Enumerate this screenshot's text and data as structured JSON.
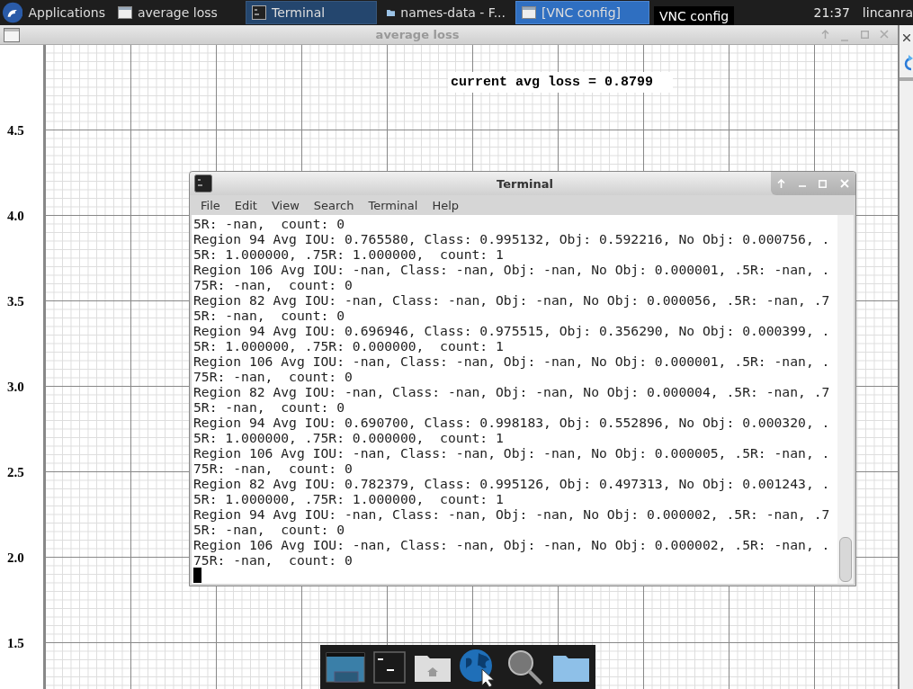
{
  "taskbar": {
    "menu": "Applications",
    "tasks": [
      {
        "label": "average loss",
        "kind": "window",
        "selected": false,
        "highlighted": false
      },
      {
        "label": "Terminal",
        "kind": "terminal",
        "selected": false,
        "highlighted": true
      },
      {
        "label": "names-data - F...",
        "kind": "folder",
        "selected": false,
        "highlighted": false
      },
      {
        "label": "[VNC config]",
        "kind": "window",
        "selected": true,
        "highlighted": false
      }
    ],
    "tooltip": "VNC config",
    "clock": "21:37",
    "user": "lincanra"
  },
  "plot_window": {
    "title": "average loss",
    "overlay_text": "current avg loss = 0.8799",
    "y_labels": [
      "4.5",
      "4.0",
      "3.5",
      "3.0",
      "2.5",
      "2.0",
      "1.5"
    ]
  },
  "terminal": {
    "title": "Terminal",
    "menu": [
      "File",
      "Edit",
      "View",
      "Search",
      "Terminal",
      "Help"
    ],
    "lines": [
      "5R: -nan,  count: 0",
      "Region 94 Avg IOU: 0.765580, Class: 0.995132, Obj: 0.592216, No Obj: 0.000756, .",
      "5R: 1.000000, .75R: 1.000000,  count: 1",
      "Region 106 Avg IOU: -nan, Class: -nan, Obj: -nan, No Obj: 0.000001, .5R: -nan, .",
      "75R: -nan,  count: 0",
      "Region 82 Avg IOU: -nan, Class: -nan, Obj: -nan, No Obj: 0.000056, .5R: -nan, .7",
      "5R: -nan,  count: 0",
      "Region 94 Avg IOU: 0.696946, Class: 0.975515, Obj: 0.356290, No Obj: 0.000399, .",
      "5R: 1.000000, .75R: 0.000000,  count: 1",
      "Region 106 Avg IOU: -nan, Class: -nan, Obj: -nan, No Obj: 0.000001, .5R: -nan, .",
      "75R: -nan,  count: 0",
      "Region 82 Avg IOU: -nan, Class: -nan, Obj: -nan, No Obj: 0.000004, .5R: -nan, .7",
      "5R: -nan,  count: 0",
      "Region 94 Avg IOU: 0.690700, Class: 0.998183, Obj: 0.552896, No Obj: 0.000320, .",
      "5R: 1.000000, .75R: 0.000000,  count: 1",
      "Region 106 Avg IOU: -nan, Class: -nan, Obj: -nan, No Obj: 0.000005, .5R: -nan, .",
      "75R: -nan,  count: 0",
      "Region 82 Avg IOU: 0.782379, Class: 0.995126, Obj: 0.497313, No Obj: 0.001243, .",
      "5R: 1.000000, .75R: 1.000000,  count: 1",
      "Region 94 Avg IOU: -nan, Class: -nan, Obj: -nan, No Obj: 0.000002, .5R: -nan, .7",
      "5R: -nan,  count: 0",
      "Region 106 Avg IOU: -nan, Class: -nan, Obj: -nan, No Obj: 0.000002, .5R: -nan, .",
      "75R: -nan,  count: 0"
    ]
  },
  "dock": {
    "items": [
      {
        "kind": "desktop"
      },
      {
        "kind": "terminal"
      },
      {
        "kind": "home"
      },
      {
        "kind": "browser"
      },
      {
        "kind": "search"
      },
      {
        "kind": "folder"
      }
    ]
  }
}
